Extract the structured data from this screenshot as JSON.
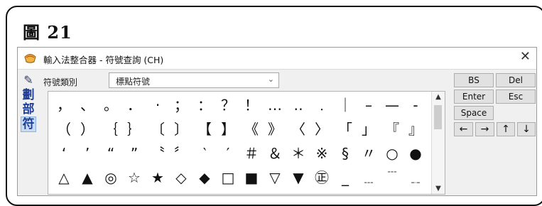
{
  "figure": {
    "title": "圖 21"
  },
  "window": {
    "title": "輸入法整合器 - 符號查詢 (CH)",
    "close_glyph": "✕"
  },
  "sidebar": {
    "tool_glyph": "✎",
    "items": [
      "劃",
      "部",
      "符"
    ]
  },
  "category": {
    "label": "符號類別",
    "selected": "標點符號",
    "chevron": "⌄"
  },
  "symbols": [
    [
      "，",
      "、",
      "。",
      "．",
      "‧",
      "；",
      "：",
      "？",
      "！",
      "…",
      "‥",
      "﹒",
      "｜",
      "–",
      "—",
      "-"
    ],
    [
      "（",
      "）",
      "｛",
      "｝",
      "〔",
      "〕",
      "【",
      "】",
      "《",
      "》",
      "〈",
      "〉",
      "「",
      "」",
      "『",
      "』"
    ],
    [
      "‘",
      "’",
      "“",
      "”",
      "〝",
      "〞",
      "‵",
      "′",
      "＃",
      "＆",
      "＊",
      "※",
      "§",
      "〃",
      "○",
      "●"
    ],
    [
      "△",
      "▲",
      "◎",
      "☆",
      "★",
      "◇",
      "◆",
      "□",
      "■",
      "▽",
      "▼",
      "㊣",
      "_",
      "﹍",
      "﹉",
      "﹎"
    ]
  ],
  "scrollbar": {
    "up": "▲",
    "down": "▼"
  },
  "buttons": {
    "bs": "BS",
    "del": "Del",
    "enter": "Enter",
    "esc": "Esc",
    "space": "Space",
    "left": "←",
    "right": "→",
    "up": "↑",
    "down": "↓"
  }
}
